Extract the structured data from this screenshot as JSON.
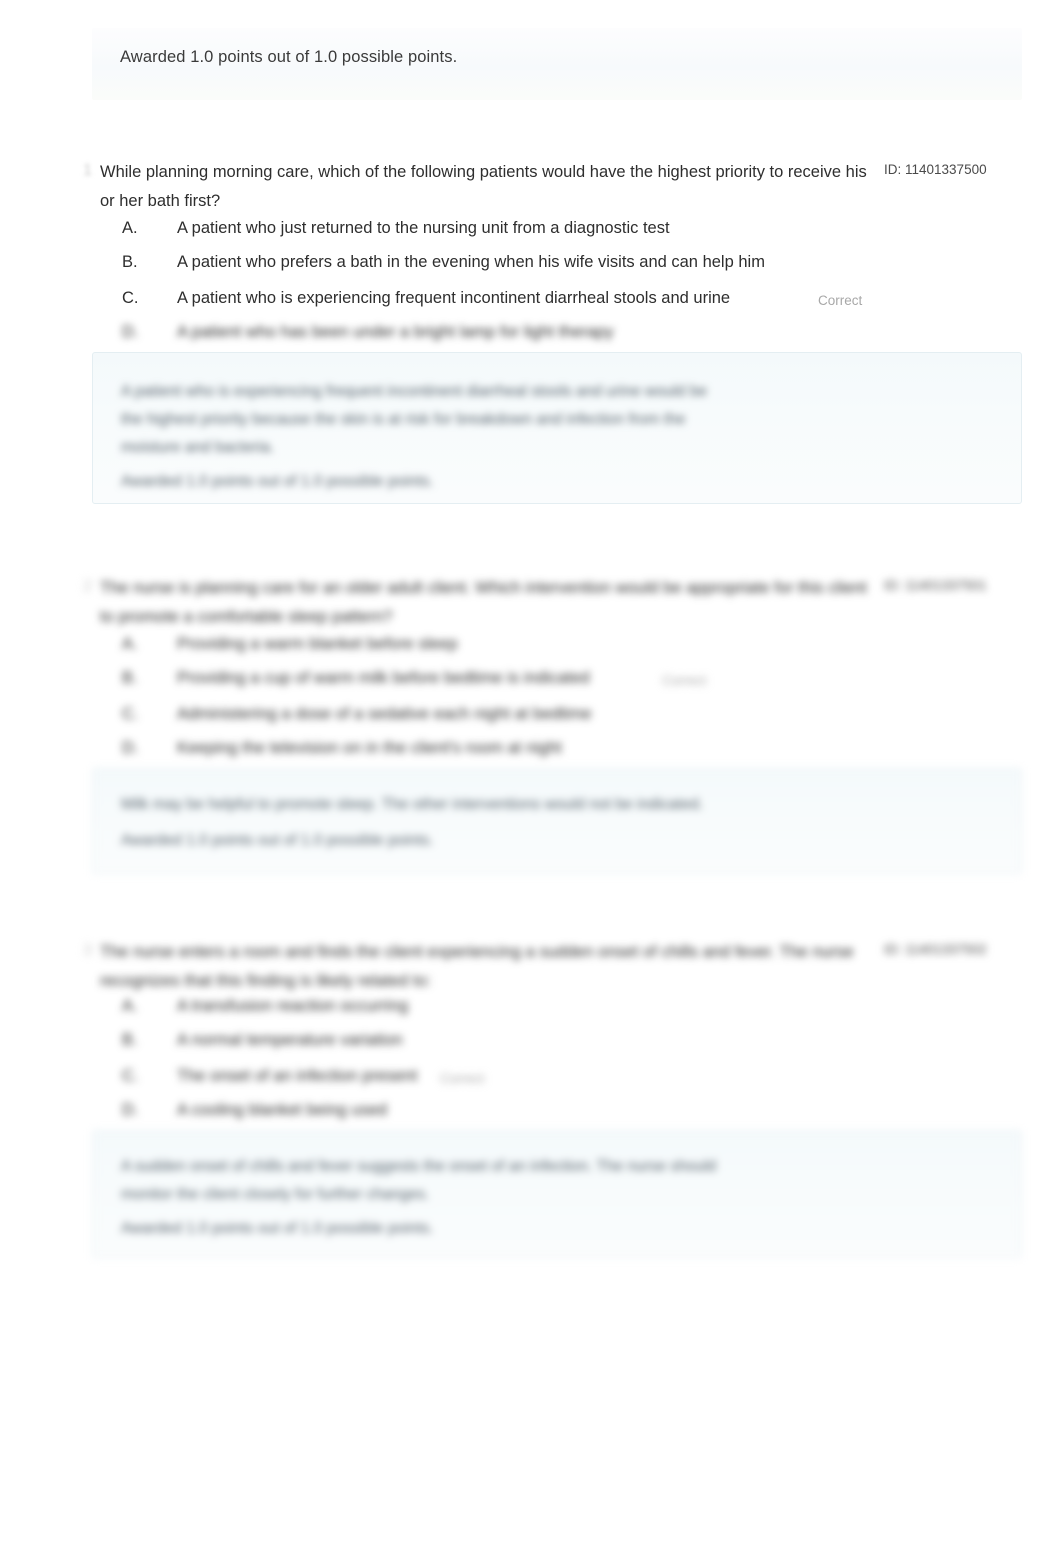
{
  "banner": {
    "awarded_text": "Awarded 1.0 points out of 1.0 possible points."
  },
  "questions": [
    {
      "number": "1",
      "id_label": "ID: 11401337500",
      "stem": "While planning morning care, which of the following patients would have the highest priority to receive his or her bath first?",
      "legible": true,
      "options": [
        {
          "letter": "A.",
          "text": "A patient who just returned to the nursing unit from a diagnostic test",
          "badge": ""
        },
        {
          "letter": "B.",
          "text": "A patient who prefers a bath in the evening when his wife visits and can help him",
          "badge": ""
        },
        {
          "letter": "C.",
          "text": "A patient who is experiencing frequent incontinent diarrheal stools and urine",
          "badge": "Correct"
        },
        {
          "letter": "D.",
          "text": "A patient who has been under a bright lamp for light therapy",
          "badge": ""
        }
      ],
      "explanation": {
        "lines": [
          "A patient who is experiencing frequent incontinent diarrheal stools and urine would be",
          "the highest priority because the skin is at risk for breakdown and infection from the",
          "moisture and bacteria.",
          "Awarded 1.0 points out of 1.0 possible points."
        ]
      }
    },
    {
      "number": "2",
      "id_label": "ID: 11401337501",
      "stem": "The nurse is planning care for an older adult client. Which intervention would be appropriate for this client to promote a comfortable sleep pattern?",
      "legible": false,
      "options": [
        {
          "letter": "A.",
          "text": "Providing a warm blanket before sleep",
          "badge": ""
        },
        {
          "letter": "B.",
          "text": "Providing a cup of warm milk before bedtime is indicated",
          "badge": "Correct"
        },
        {
          "letter": "C.",
          "text": "Administering a dose of a sedative each night at bedtime",
          "badge": ""
        },
        {
          "letter": "D.",
          "text": "Keeping the television on in the client's room at night",
          "badge": ""
        }
      ],
      "explanation": {
        "lines": [
          "Milk may be helpful to promote sleep. The other interventions would not be indicated.",
          "Awarded 1.0 points out of 1.0 possible points."
        ]
      }
    },
    {
      "number": "3",
      "id_label": "ID: 11401337502",
      "stem": "The nurse enters a room and finds the client experiencing a sudden onset of chills and fever. The nurse recognizes that this finding is likely related to:",
      "legible": false,
      "options": [
        {
          "letter": "A.",
          "text": "A transfusion reaction occurring",
          "badge": ""
        },
        {
          "letter": "B.",
          "text": "A normal temperature variation",
          "badge": ""
        },
        {
          "letter": "C.",
          "text": "The onset of an infection present",
          "badge": "Correct"
        },
        {
          "letter": "D.",
          "text": "A cooling blanket being used",
          "badge": ""
        }
      ],
      "explanation": {
        "lines": [
          "A sudden onset of chills and fever suggests the onset of an infection. The nurse should",
          "monitor the client closely for further changes.",
          "Awarded 1.0 points out of 1.0 possible points."
        ]
      }
    }
  ]
}
